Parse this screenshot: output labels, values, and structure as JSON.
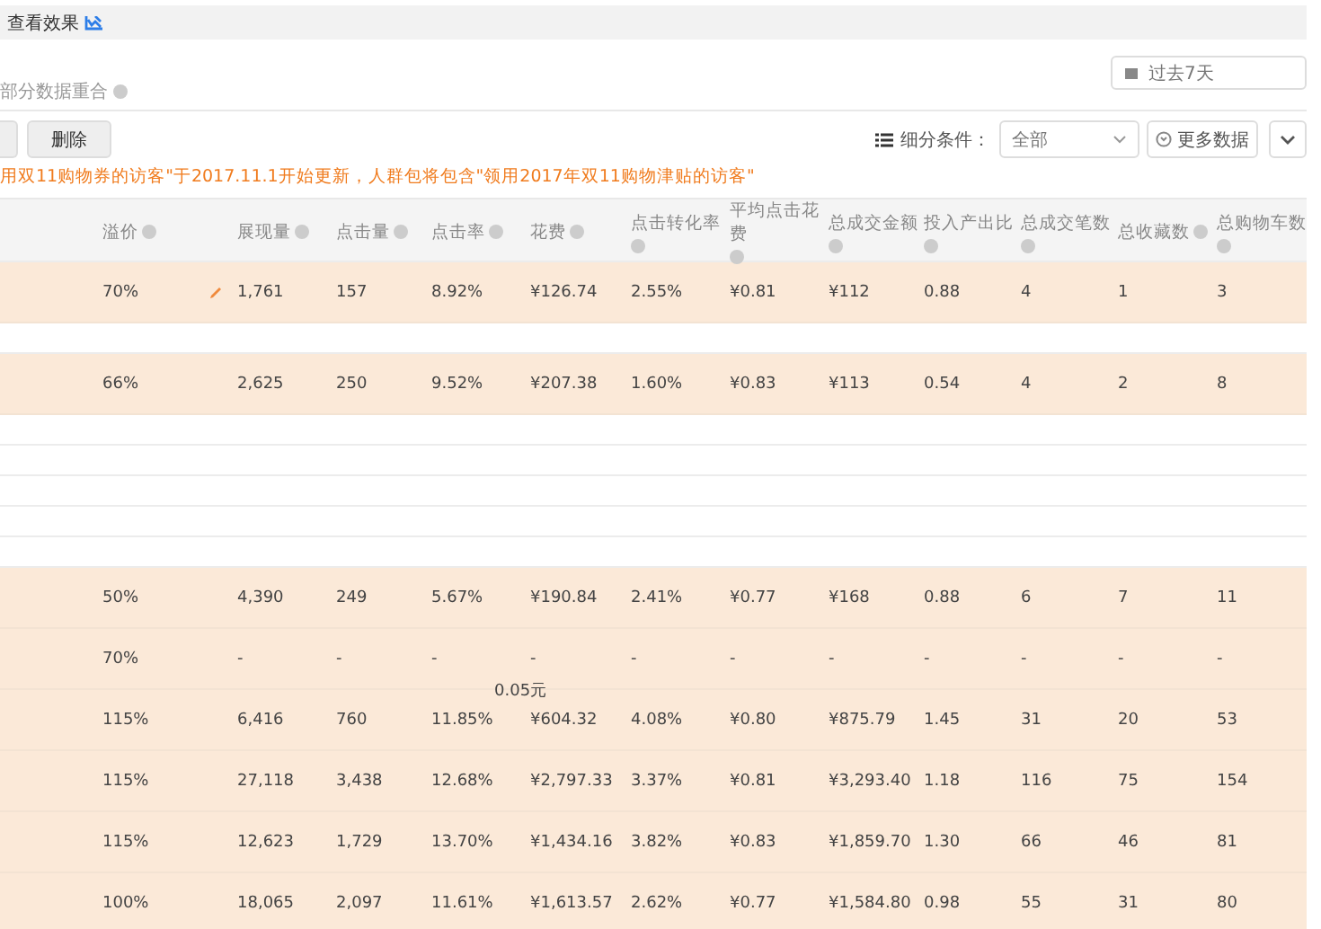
{
  "header": {
    "title": "查看效果"
  },
  "date_field": {
    "value": "过去7天"
  },
  "overlap_note": "部分数据重合",
  "delete_button": "删除",
  "filter": {
    "label": "细分条件：",
    "value": "全部"
  },
  "more_button": "更多数据",
  "notice": "用双11购物券的访客\"于2017.11.1开始更新，人群包将包含\"领用2017年双11购物津贴的访客\"",
  "table": {
    "columns": [
      "溢价",
      "展现量",
      "点击量",
      "点击率",
      "花费",
      "点击转化率",
      "平均点击花费",
      "总成交金额",
      "投入产出比",
      "总成交笔数",
      "总收藏数",
      "总购物车数"
    ],
    "rows": [
      {
        "kind": "data",
        "editable": true,
        "cells": [
          "70%",
          "1,761",
          "157",
          "8.92%",
          "¥126.74",
          "2.55%",
          "¥0.81",
          "¥112",
          "0.88",
          "4",
          "1",
          "3"
        ]
      },
      {
        "kind": "blank"
      },
      {
        "kind": "data",
        "editable": false,
        "cells": [
          "66%",
          "2,625",
          "250",
          "9.52%",
          "¥207.38",
          "1.60%",
          "¥0.83",
          "¥113",
          "0.54",
          "4",
          "2",
          "8"
        ]
      },
      {
        "kind": "blank"
      },
      {
        "kind": "blank"
      },
      {
        "kind": "blank"
      },
      {
        "kind": "blank"
      },
      {
        "kind": "blank"
      },
      {
        "kind": "data",
        "editable": false,
        "cells": [
          "50%",
          "4,390",
          "249",
          "5.67%",
          "¥190.84",
          "2.41%",
          "¥0.77",
          "¥168",
          "0.88",
          "6",
          "7",
          "11"
        ]
      },
      {
        "kind": "data",
        "editable": false,
        "cells": [
          "70%",
          "-",
          "-",
          "-",
          "-",
          "-",
          "-",
          "-",
          "-",
          "-",
          "-",
          "-"
        ],
        "spend_note": "0.05元"
      },
      {
        "kind": "data",
        "editable": false,
        "cells": [
          "115%",
          "6,416",
          "760",
          "11.85%",
          "¥604.32",
          "4.08%",
          "¥0.80",
          "¥875.79",
          "1.45",
          "31",
          "20",
          "53"
        ]
      },
      {
        "kind": "data",
        "editable": false,
        "cells": [
          "115%",
          "27,118",
          "3,438",
          "12.68%",
          "¥2,797.33",
          "3.37%",
          "¥0.81",
          "¥3,293.40",
          "1.18",
          "116",
          "75",
          "154"
        ]
      },
      {
        "kind": "data",
        "editable": false,
        "cells": [
          "115%",
          "12,623",
          "1,729",
          "13.70%",
          "¥1,434.16",
          "3.82%",
          "¥0.83",
          "¥1,859.70",
          "1.30",
          "66",
          "46",
          "81"
        ]
      },
      {
        "kind": "data",
        "editable": false,
        "cells": [
          "100%",
          "18,065",
          "2,097",
          "11.61%",
          "¥1,613.57",
          "2.62%",
          "¥0.77",
          "¥1,584.80",
          "0.98",
          "55",
          "31",
          "80"
        ]
      }
    ]
  }
}
